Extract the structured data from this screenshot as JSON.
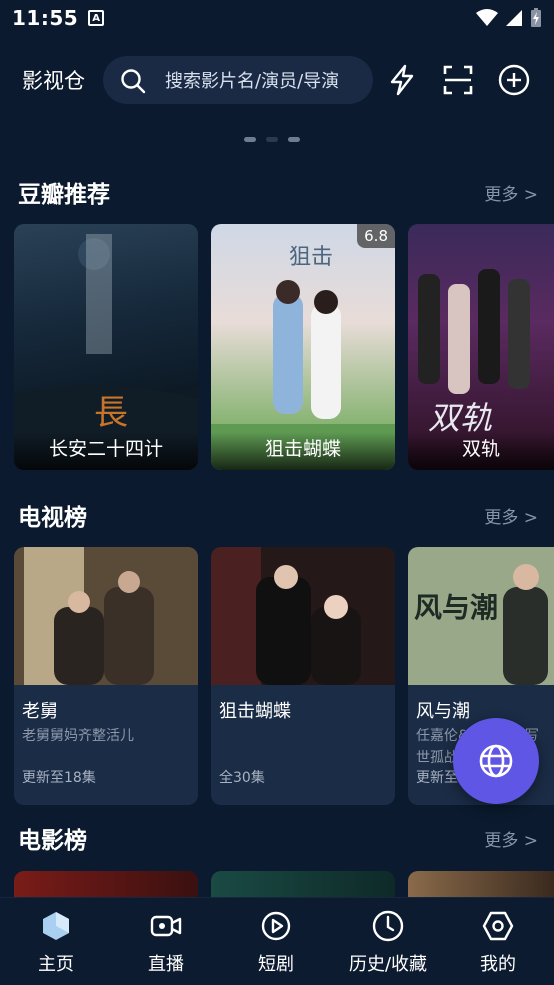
{
  "status_bar": {
    "time": "11:55",
    "notif_letter": "A"
  },
  "header": {
    "app_title": "影视仓",
    "search_placeholder": "搜索影片名/演员/导演"
  },
  "sections": {
    "douban": {
      "title": "豆瓣推荐",
      "more": "更多 >",
      "items": [
        {
          "title": "长安二十四计"
        },
        {
          "title": "狙击蝴蝶",
          "rating": "6.8"
        },
        {
          "title": "双轨"
        }
      ]
    },
    "tv": {
      "title": "电视榜",
      "more": "更多 >",
      "items": [
        {
          "title": "老舅",
          "desc": "老舅舅妈齐整活儿",
          "status": "更新至18集"
        },
        {
          "title": "狙击蝴蝶",
          "desc": "",
          "status": "全30集"
        },
        {
          "title": "风与潮",
          "desc": "任嘉伦&林雨申谱写世孤战传奇",
          "status": "更新至2"
        }
      ]
    },
    "movie": {
      "title": "电影榜",
      "more": "更多 >"
    }
  },
  "bottom_nav": [
    {
      "label": "主页",
      "icon": "home-icon"
    },
    {
      "label": "直播",
      "icon": "live-camera-icon"
    },
    {
      "label": "短剧",
      "icon": "play-circle-icon"
    },
    {
      "label": "历史/收藏",
      "icon": "clock-icon"
    },
    {
      "label": "我的",
      "icon": "profile-hexagon-icon"
    }
  ],
  "colors": {
    "background": "#0b1a2e",
    "card": "#1b2c46",
    "accent": "#6056e6",
    "search_bg": "#1a2a44"
  }
}
